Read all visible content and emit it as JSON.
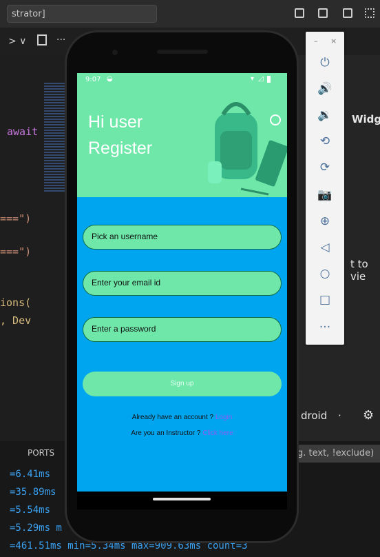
{
  "ide": {
    "title": "strator]",
    "toolbar_chevron": "> ∨",
    "toolbar_more": "···",
    "code_lines": [
      "await",
      "===\")",
      "===\")",
      "ions(",
      ", Dev"
    ],
    "right_pane": {
      "tab_widget": "Widg",
      "hint": "t to vie",
      "droid": "droid",
      "dot": "·"
    },
    "panel": {
      "tab_ports": "PORTS",
      "filter_placeholder": "g. text, !exclude)",
      "terminal_lines": [
        "=6.41ms",
        "=35.89ms",
        "=5.54ms",
        "=5.29ms m",
        "=461.51ms min=5.34ms max=909.63ms count=3"
      ]
    }
  },
  "emulator": {
    "window_controls": {
      "minimize": "–",
      "close": "×"
    },
    "buttons": [
      {
        "name": "power-icon",
        "glyph": "⏻"
      },
      {
        "name": "volume-up-icon",
        "glyph": "🔊"
      },
      {
        "name": "volume-down-icon",
        "glyph": "🔉"
      },
      {
        "name": "rotate-left-icon",
        "glyph": "⟲"
      },
      {
        "name": "rotate-right-icon",
        "glyph": "⟳"
      },
      {
        "name": "camera-icon",
        "glyph": "📷"
      },
      {
        "name": "zoom-icon",
        "glyph": "⊕"
      },
      {
        "name": "back-icon",
        "glyph": "◁"
      },
      {
        "name": "home-icon",
        "glyph": "○"
      },
      {
        "name": "overview-icon",
        "glyph": "□"
      },
      {
        "name": "more-icon",
        "glyph": "···"
      }
    ]
  },
  "app": {
    "status_time": "9:07",
    "greeting": "Hi user",
    "heading": "Register",
    "username_placeholder": "Pick an username",
    "email_placeholder": "Enter your email id",
    "password_placeholder": "Enter a password",
    "signup_label": "Sign up",
    "account_prompt": "Already have an account ?",
    "login_link": "Login",
    "instructor_prompt": "Are you an Instructor ?",
    "instructor_link": "Click here"
  },
  "colors": {
    "header_green": "#6ee7a9",
    "screen_blue": "#00a5ef",
    "link_purple": "#8c5cf0"
  }
}
